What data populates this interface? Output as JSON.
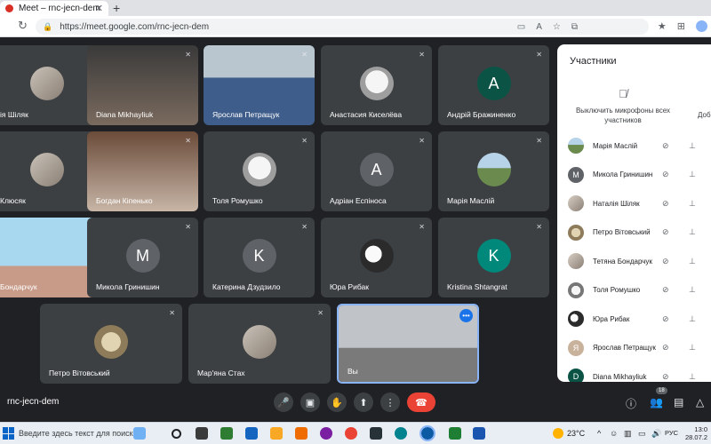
{
  "browser": {
    "tab_title": "Meet – rnc-jecn-dem",
    "url": "https://meet.google.com/rnc-jecn-dem"
  },
  "tiles": [
    {
      "name": "ія Шіляк",
      "avatar": "photo"
    },
    {
      "name": "Diana Mikhayliuk",
      "avatar": "video"
    },
    {
      "name": "Ярослав Петращук",
      "avatar": "video"
    },
    {
      "name": "Анастасия Киселёва",
      "avatar": "sketch"
    },
    {
      "name": "Андрій Бражиненко",
      "avatar": "letter",
      "letter": "A",
      "color": "#0b5345"
    },
    {
      "name": "Клюсяк",
      "avatar": "photo"
    },
    {
      "name": "Богдан Кіпенько",
      "avatar": "video"
    },
    {
      "name": "Толя Ромушко",
      "avatar": "sketch"
    },
    {
      "name": "Адріан Еспіноса",
      "avatar": "letter",
      "letter": "A",
      "color": "#5f6368"
    },
    {
      "name": "Марія Маслій",
      "avatar": "field"
    },
    {
      "name": "Бондарчук",
      "avatar": "video"
    },
    {
      "name": "Микола Гринишин",
      "avatar": "letter",
      "letter": "M",
      "color": "#5f6368"
    },
    {
      "name": "Катерина Дзудзило",
      "avatar": "letter",
      "letter": "K",
      "color": "#5f6368"
    },
    {
      "name": "Юра Рибак",
      "avatar": "puppy"
    },
    {
      "name": "Kristina Shtangrat",
      "avatar": "letter",
      "letter": "K",
      "color": "#00897b"
    },
    {
      "name": "Петро Вітовський",
      "avatar": "cat"
    },
    {
      "name": "Мар'яна Стах",
      "avatar": "photo"
    },
    {
      "name": "Вы",
      "avatar": "video"
    }
  ],
  "panel": {
    "title": "Участники",
    "mute_all_label": "Выключить микрофоны всех участников",
    "mute_all_label_2": "Доб",
    "participants": [
      {
        "name": "Марія Маслій",
        "avatar": "field"
      },
      {
        "name": "Микола Гринишин",
        "avatar": "letter",
        "letter": "M",
        "color": "#5f6368"
      },
      {
        "name": "Наталія Шіляк",
        "avatar": "photo"
      },
      {
        "name": "Петро Вітовський",
        "avatar": "cat"
      },
      {
        "name": "Тетяна Бондарчук",
        "avatar": "photo"
      },
      {
        "name": "Толя Ромушко",
        "avatar": "sketch"
      },
      {
        "name": "Юра Рибак",
        "avatar": "puppy"
      },
      {
        "name": "Ярослав Петращук",
        "avatar": "letter",
        "letter": "Я",
        "color": "#c9b29b"
      },
      {
        "name": "Diana Mikhayliuk",
        "avatar": "letter",
        "letter": "D",
        "color": "#0b5345"
      }
    ]
  },
  "meetbar": {
    "meeting_code": "rnc-jecn-dem",
    "participant_count": "18"
  },
  "taskbar": {
    "search_placeholder": "Введите здесь текст для поиска",
    "temperature": "23°C",
    "language": "РУС",
    "time": "13:0",
    "date": "28.07.2"
  },
  "colors": {
    "meet_bg": "#202124",
    "tile_bg": "#3c4043",
    "end_call": "#ea4335",
    "self_border": "#8ab4f8"
  }
}
